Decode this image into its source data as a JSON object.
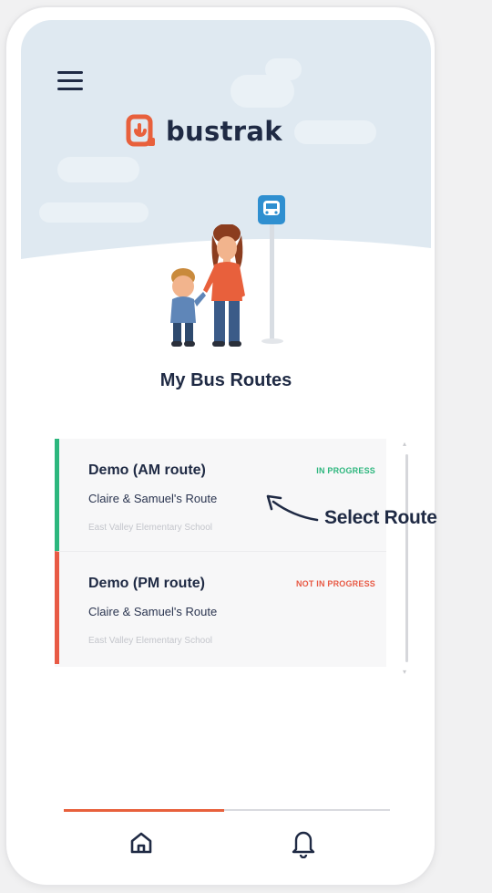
{
  "app": {
    "name": "bustrak",
    "brand_color": "#e8603c",
    "text_color": "#1f2a44"
  },
  "header": {
    "menu_icon": "hamburger-menu-icon",
    "logo_icon": "bustrak-logo-icon"
  },
  "page": {
    "title": "My Bus Routes"
  },
  "routes": [
    {
      "name": "Demo (AM route)",
      "status": "IN PROGRESS",
      "status_color": "#2cb67d",
      "subtitle": "Claire & Samuel's Route",
      "school": "East Valley Elementary School"
    },
    {
      "name": "Demo (PM route)",
      "status": "NOT IN PROGRESS",
      "status_color": "#e85a45",
      "subtitle": "Claire & Samuel's Route",
      "school": "East Valley Elementary School"
    }
  ],
  "annotation": {
    "text": "Select Route"
  },
  "tabs": [
    {
      "icon": "home-icon",
      "active": true
    },
    {
      "icon": "bell-icon",
      "active": false
    }
  ]
}
